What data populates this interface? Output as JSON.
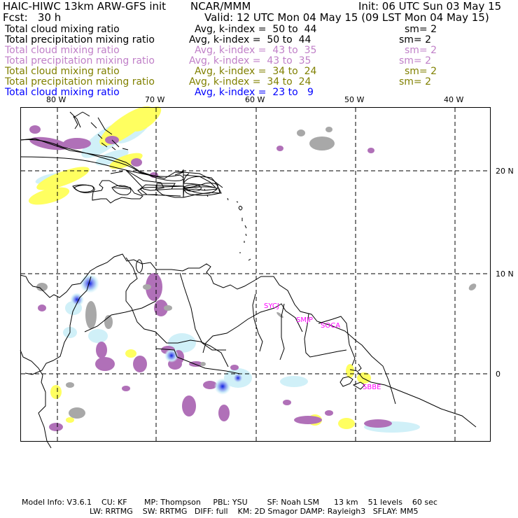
{
  "header": {
    "title": "HAIC-HIWC 13km ARW-GFS init",
    "org": "NCAR/MMM",
    "init": "Init: 06 UTC Sun 03 May 15",
    "fcst": "Fcst:   30 h",
    "valid": "Valid: 12 UTC Mon 04 May 15 (09 LST Mon 04 May 15)"
  },
  "legend": [
    {
      "name": "Total cloud mixing ratio",
      "avg": "Avg, k-index =  50 to  44",
      "sm": "sm= 2",
      "color": "#000000"
    },
    {
      "name": "Total precipitation mixing ratio",
      "avg": "Avg, k-index =  50 to  44",
      "sm": "sm= 2",
      "color": "#000000"
    },
    {
      "name": "Total cloud mixing ratio",
      "avg": "Avg, k-index =  43 to  35",
      "sm": "sm= 2",
      "color": "#c080c8"
    },
    {
      "name": "Total precipitation mixing ratio",
      "avg": "Avg, k-index =  43 to  35",
      "sm": "sm= 2",
      "color": "#c080c8"
    },
    {
      "name": "Total cloud mixing ratio",
      "avg": "Avg, k-index =  34 to  24",
      "sm": "sm= 2",
      "color": "#808000"
    },
    {
      "name": "Total precipitation mixing ratio",
      "avg": "Avg, k-index =  34 to  24",
      "sm": "sm= 2",
      "color": "#808000"
    },
    {
      "name": "Total cloud mixing ratio",
      "avg": "Avg, k-index =  23 to   9",
      "sm": "",
      "color": "#0000ff"
    }
  ],
  "map": {
    "lon_labels": [
      "80 W",
      "70 W",
      "60 W",
      "50 W",
      "40 W"
    ],
    "lat_labels": [
      "20 N",
      "10 N",
      "0"
    ],
    "stations": [
      "SYCJ",
      "SMJP",
      "SOCA",
      "SBBE"
    ],
    "station_color": "#ff00ff",
    "colors": {
      "gray": "#a8a8a8",
      "purple": "#b070b8",
      "yellow": "#ffff60",
      "lightblue": "#d0f0f8",
      "blue": "#2030e0"
    }
  },
  "footer": {
    "line1": "Model Info: V3.6.1    CU: KF       MP: Thompson     PBL: YSU        SF: Noah LSM      13 km    51 levels    60 sec",
    "line2": "LW: RRTMG    SW: RRTMG   DIFF: full    KM: 2D Smagor DAMP: Rayleigh3   SFLAY: MM5"
  }
}
